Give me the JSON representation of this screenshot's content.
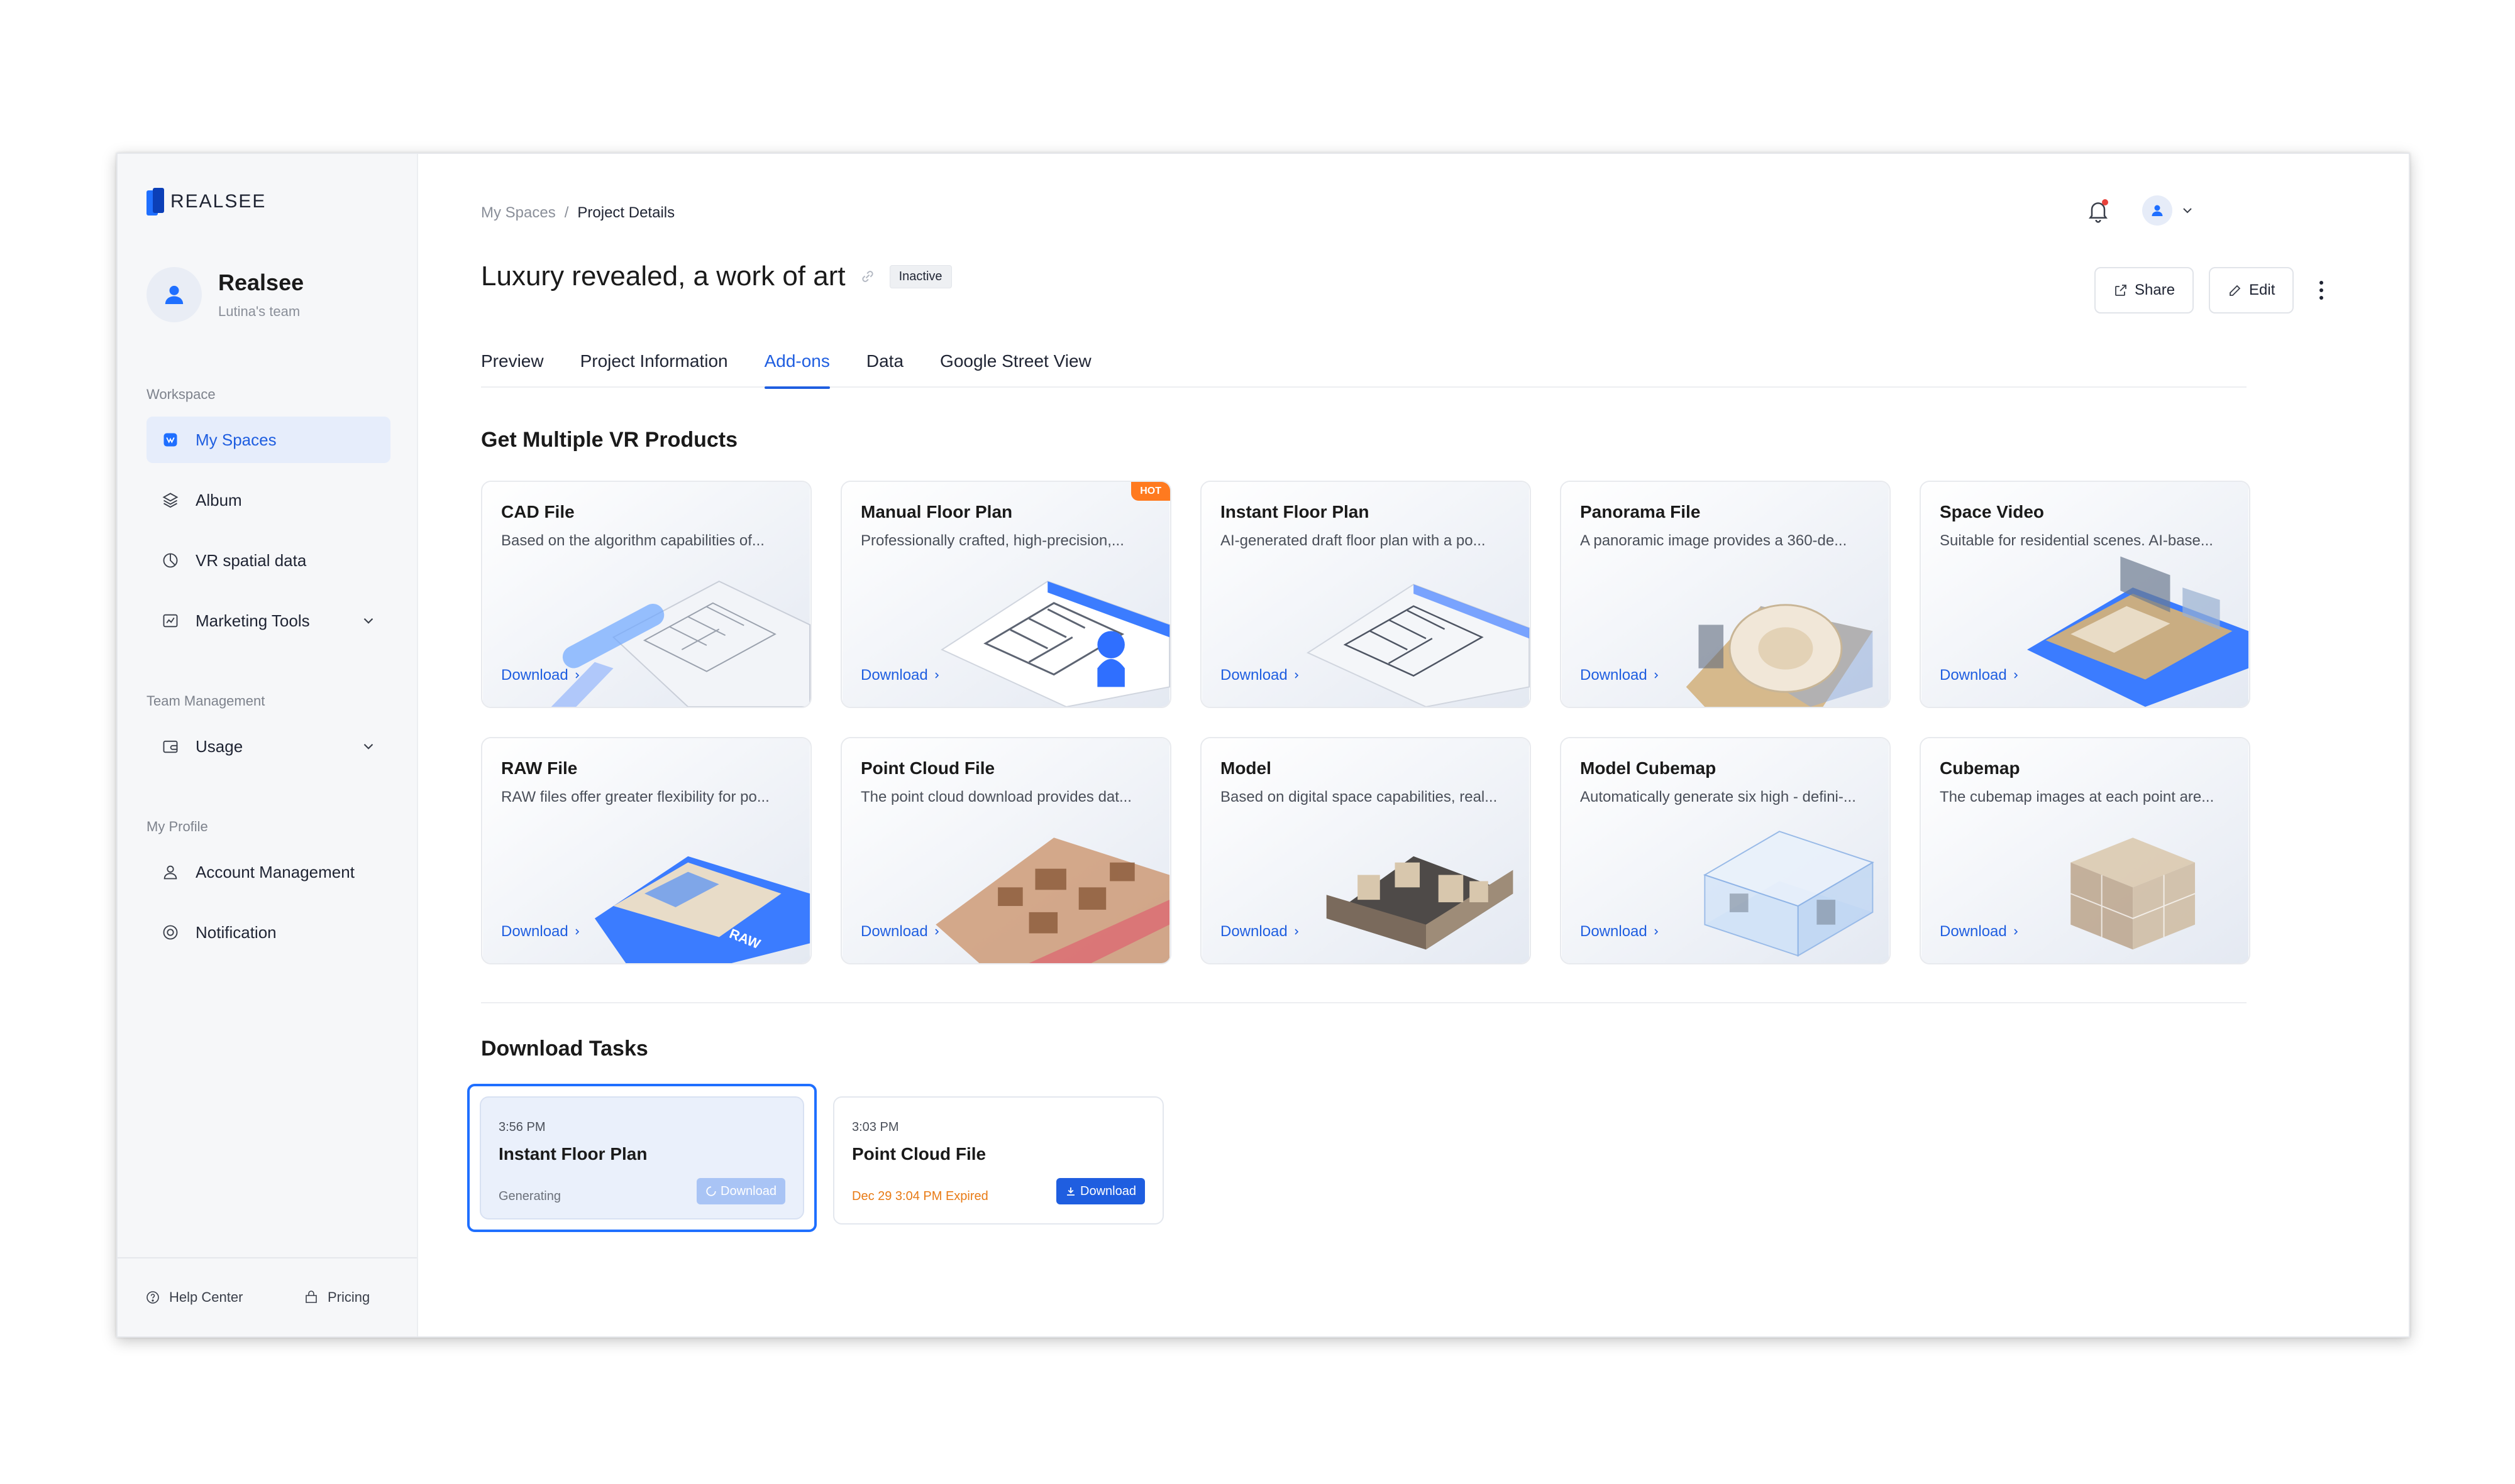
{
  "brand": {
    "name": "REALSEE"
  },
  "profile": {
    "name": "Realsee",
    "team": "Lutina's team"
  },
  "sidebar": {
    "workspace_label": "Workspace",
    "workspace_items": [
      {
        "label": "My Spaces",
        "icon": "spaces-icon",
        "active": true
      },
      {
        "label": "Album",
        "icon": "layers-icon"
      },
      {
        "label": "VR spatial data",
        "icon": "pie-chart-icon"
      },
      {
        "label": "Marketing Tools",
        "icon": "chart-icon",
        "expandable": true
      }
    ],
    "team_label": "Team Management",
    "team_items": [
      {
        "label": "Usage",
        "icon": "wallet-icon",
        "expandable": true
      }
    ],
    "profile_label": "My Profile",
    "profile_items": [
      {
        "label": "Account Management",
        "icon": "user-icon"
      },
      {
        "label": "Notification",
        "icon": "target-icon"
      }
    ],
    "footer": {
      "help": "Help Center",
      "pricing": "Pricing"
    }
  },
  "breadcrumb": {
    "root": "My Spaces",
    "separator": "/",
    "current": "Project Details"
  },
  "project": {
    "title": "Luxury revealed, a work of art",
    "status": "Inactive"
  },
  "actions": {
    "share": "Share",
    "edit": "Edit"
  },
  "tabs": [
    {
      "label": "Preview"
    },
    {
      "label": "Project Information"
    },
    {
      "label": "Add-ons",
      "active": true
    },
    {
      "label": "Data"
    },
    {
      "label": "Google Street View"
    }
  ],
  "products": {
    "heading": "Get Multiple VR Products",
    "link_label": "Download",
    "items": [
      {
        "title": "CAD File",
        "desc": "Based on the algorithm capabilities of...",
        "art": "cad"
      },
      {
        "title": "Manual Floor Plan",
        "desc": "Professionally crafted, high-precision,...",
        "art": "manual",
        "badge": "HOT"
      },
      {
        "title": "Instant Floor Plan",
        "desc": "AI-generated draft floor plan with a po...",
        "art": "instant"
      },
      {
        "title": "Panorama File",
        "desc": "A panoramic image provides a 360-de...",
        "art": "pano"
      },
      {
        "title": "Space Video",
        "desc": "Suitable for residential scenes. AI-base...",
        "art": "video"
      },
      {
        "title": "RAW File",
        "desc": "RAW files offer greater flexibility for po...",
        "art": "raw",
        "art_label": "RAW"
      },
      {
        "title": "Point Cloud File",
        "desc": "The point cloud download provides dat...",
        "art": "cloud"
      },
      {
        "title": "Model",
        "desc": "Based on digital space capabilities, real...",
        "art": "model"
      },
      {
        "title": "Model Cubemap",
        "desc": "Automatically generate six high - defini-...",
        "art": "cubemap"
      },
      {
        "title": "Cubemap",
        "desc": "The cubemap images at each point are...",
        "art": "cube"
      }
    ]
  },
  "downloads": {
    "heading": "Download Tasks",
    "tasks": [
      {
        "time": "3:56 PM",
        "name": "Instant Floor Plan",
        "status": "Generating",
        "button": "Download",
        "state": "generating"
      },
      {
        "time": "3:03 PM",
        "name": "Point Cloud File",
        "status": "Dec 29 3:04 PM Expired",
        "button": "Download",
        "state": "ready"
      }
    ]
  },
  "colors": {
    "accent": "#1f5ee0",
    "hot": "#ff7a1f",
    "expired": "#e87a14"
  }
}
